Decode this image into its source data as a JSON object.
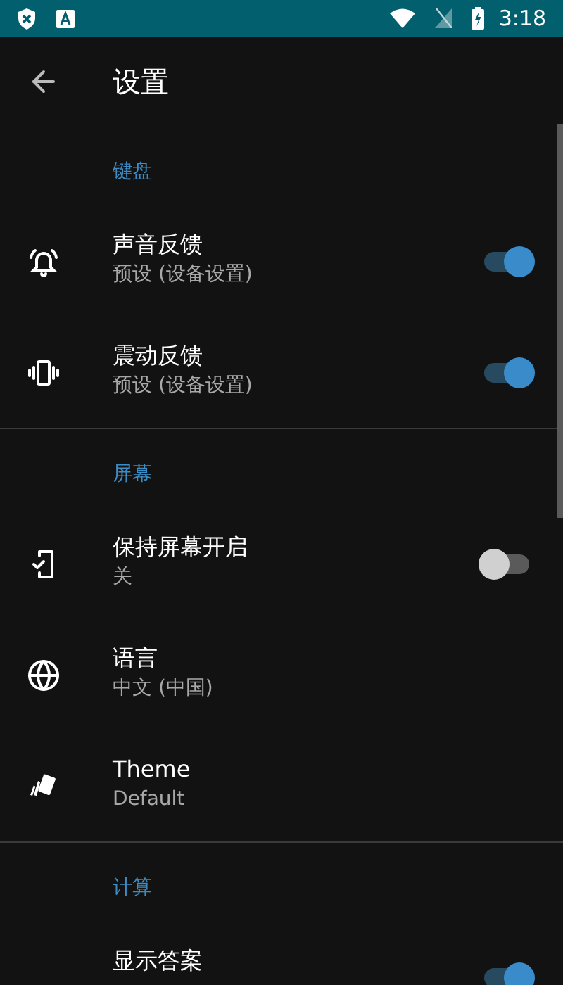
{
  "status_bar": {
    "time": "3:18"
  },
  "app_bar": {
    "title": "设置"
  },
  "sections": [
    {
      "title": "键盘",
      "items": [
        {
          "kind": "toggle",
          "title": "声音反馈",
          "summary": "预设 (设备设置)",
          "on": true
        },
        {
          "kind": "toggle",
          "title": "震动反馈",
          "summary": "预设 (设备设置)",
          "on": true
        }
      ]
    },
    {
      "title": "屏幕",
      "items": [
        {
          "kind": "toggle",
          "title": "保持屏幕开启",
          "summary": "关",
          "on": false
        },
        {
          "kind": "value",
          "title": "语言",
          "summary": "中文 (中国)"
        },
        {
          "kind": "value",
          "title": "Theme",
          "summary": "Default"
        }
      ]
    },
    {
      "title": "计算",
      "items": [
        {
          "kind": "toggle",
          "title": "显示答案",
          "on": true
        }
      ]
    }
  ]
}
